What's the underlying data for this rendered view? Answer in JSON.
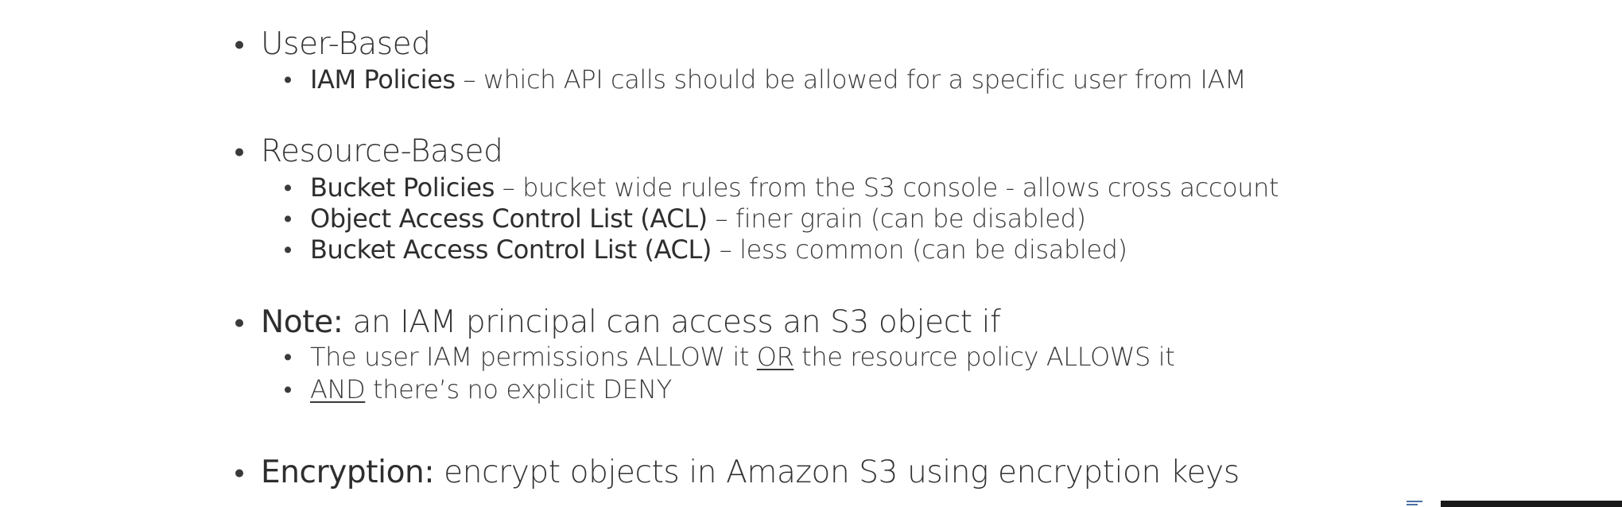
{
  "sections": [
    {
      "heading": {
        "lead": "",
        "rest": "User-Based"
      },
      "items": [
        {
          "lead": "IAM Policies",
          "rest": " – which API calls should be allowed for a specific user from IAM"
        }
      ]
    },
    {
      "heading": {
        "lead": "",
        "rest": "Resource-Based"
      },
      "items": [
        {
          "lead": "Bucket Policies",
          "rest": " – bucket wide rules from the S3 console - allows cross account"
        },
        {
          "lead": "Object Access Control List (ACL)",
          "rest": " – finer grain (can be disabled)"
        },
        {
          "lead": "Bucket Access Control List (ACL)",
          "rest": " – less common (can be disabled)"
        }
      ]
    },
    {
      "heading": {
        "lead": "Note:",
        "rest": " an IAM principal can access an S3 object if"
      },
      "items": [
        {
          "a": "The user IAM permissions ALLOW it ",
          "u": "OR",
          "b": " the resource policy ALLOWS it"
        },
        {
          "u": "AND",
          "b": " there’s no explicit DENY"
        }
      ]
    },
    {
      "heading": {
        "lead": "Encryption:",
        "rest": " encrypt objects in Amazon S3 using encryption keys"
      },
      "items": []
    }
  ]
}
